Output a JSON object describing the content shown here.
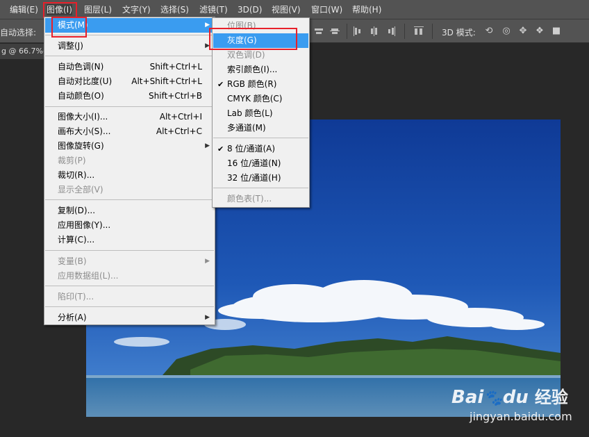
{
  "menubar": {
    "items": [
      "编辑(E)",
      "图像(I)",
      "图层(L)",
      "文字(Y)",
      "选择(S)",
      "滤镜(T)",
      "3D(D)",
      "视图(V)",
      "窗口(W)",
      "帮助(H)"
    ]
  },
  "options": {
    "auto_select": "自动选择:",
    "mode_3d": "3D 模式:"
  },
  "doc_tab": "g @ 66.7%(",
  "image_menu": {
    "items": [
      {
        "label": "模式(M)",
        "shortcut": "",
        "submenu": true,
        "highlighted": true
      },
      {
        "label": "调整(J)",
        "shortcut": "",
        "submenu": true
      },
      {
        "label": "自动色调(N)",
        "shortcut": "Shift+Ctrl+L"
      },
      {
        "label": "自动对比度(U)",
        "shortcut": "Alt+Shift+Ctrl+L"
      },
      {
        "label": "自动颜色(O)",
        "shortcut": "Shift+Ctrl+B"
      },
      {
        "label": "图像大小(I)...",
        "shortcut": "Alt+Ctrl+I"
      },
      {
        "label": "画布大小(S)...",
        "shortcut": "Alt+Ctrl+C"
      },
      {
        "label": "图像旋转(G)",
        "shortcut": "",
        "submenu": true
      },
      {
        "label": "裁剪(P)",
        "shortcut": "",
        "disabled": true
      },
      {
        "label": "裁切(R)...",
        "shortcut": ""
      },
      {
        "label": "显示全部(V)",
        "shortcut": "",
        "disabled": true
      },
      {
        "label": "复制(D)...",
        "shortcut": ""
      },
      {
        "label": "应用图像(Y)...",
        "shortcut": ""
      },
      {
        "label": "计算(C)...",
        "shortcut": ""
      },
      {
        "label": "变量(B)",
        "shortcut": "",
        "submenu": true,
        "disabled": true
      },
      {
        "label": "应用数据组(L)...",
        "shortcut": "",
        "disabled": true
      },
      {
        "label": "陷印(T)...",
        "shortcut": "",
        "disabled": true
      },
      {
        "label": "分析(A)",
        "shortcut": "",
        "submenu": true
      }
    ]
  },
  "mode_menu": {
    "items": [
      {
        "label": "位图(B)",
        "disabled": true
      },
      {
        "label": "灰度(G)",
        "highlighted": true
      },
      {
        "label": "双色调(D)",
        "disabled": true
      },
      {
        "label": "索引颜色(I)..."
      },
      {
        "label": "RGB 颜色(R)",
        "checked": true
      },
      {
        "label": "CMYK 颜色(C)"
      },
      {
        "label": "Lab 颜色(L)"
      },
      {
        "label": "多通道(M)"
      },
      {
        "label": "8 位/通道(A)",
        "checked": true
      },
      {
        "label": "16 位/通道(N)"
      },
      {
        "label": "32 位/通道(H)"
      },
      {
        "label": "颜色表(T)...",
        "disabled": true
      }
    ]
  },
  "watermark": {
    "brand": "Bai",
    "brand2": "du",
    "brand_cn": "经验",
    "url": "jingyan.baidu.com"
  },
  "colors": {
    "highlight": "#3a9cf0",
    "annotation_red": "#e8202a"
  }
}
